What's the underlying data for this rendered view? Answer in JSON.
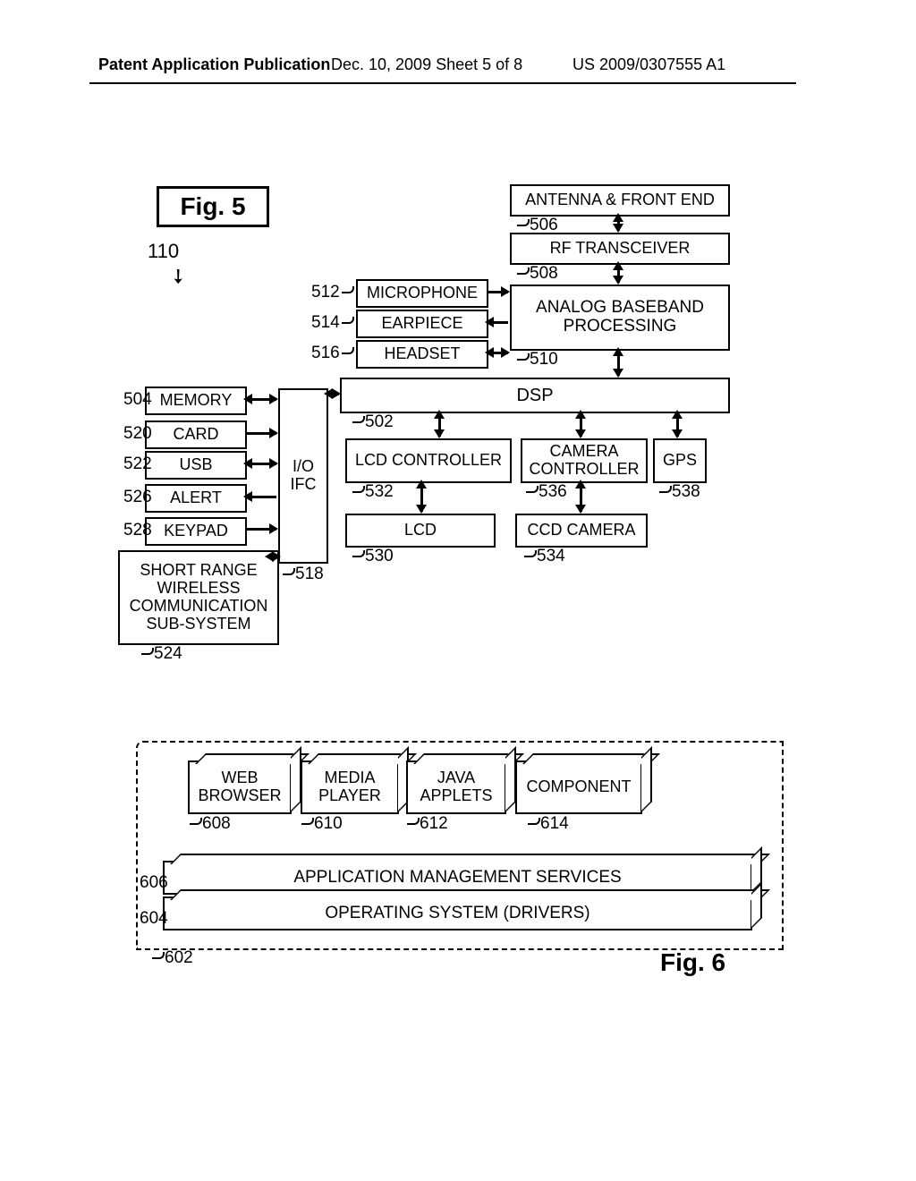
{
  "header": {
    "left": "Patent Application Publication",
    "mid": "Dec. 10, 2009   Sheet 5 of 8",
    "right": "US 2009/0307555 A1"
  },
  "fig5": {
    "title": "Fig. 5",
    "ref110": "110",
    "blocks": {
      "b506": "ANTENNA & FRONT END",
      "b508": "RF TRANSCEIVER",
      "b510": "ANALOG BASEBAND PROCESSING",
      "b512": "MICROPHONE",
      "b514": "EARPIECE",
      "b516": "HEADSET",
      "b502": "DSP",
      "b504": "MEMORY",
      "b520": "CARD",
      "b522": "USB",
      "b526": "ALERT",
      "b528": "KEYPAD",
      "b524": "SHORT RANGE WIRELESS COMMUNICATION SUB-SYSTEM",
      "b518": "I/O IFC",
      "b532": "LCD CONTROLLER",
      "b536": "CAMERA CONTROLLER",
      "b538": "GPS",
      "b530": "LCD",
      "b534": "CCD CAMERA"
    },
    "refs": {
      "r506": "506",
      "r508": "508",
      "r510": "510",
      "r512": "512",
      "r514": "514",
      "r516": "516",
      "r502": "502",
      "r504": "504",
      "r520": "520",
      "r522": "522",
      "r526": "526",
      "r528": "528",
      "r524": "524",
      "r518": "518",
      "r532": "532",
      "r536": "536",
      "r538": "538",
      "r530": "530",
      "r534": "534"
    }
  },
  "fig6": {
    "title": "Fig. 6",
    "blocks": {
      "b608": "WEB BROWSER",
      "b610": "MEDIA PLAYER",
      "b612": "JAVA APPLETS",
      "b614": "COMPONENT",
      "b606": "APPLICATION MANAGEMENT SERVICES",
      "b604": "OPERATING SYSTEM (DRIVERS)"
    },
    "refs": {
      "r608": "608",
      "r610": "610",
      "r612": "612",
      "r614": "614",
      "r606": "606",
      "r604": "604",
      "r602": "602"
    }
  }
}
